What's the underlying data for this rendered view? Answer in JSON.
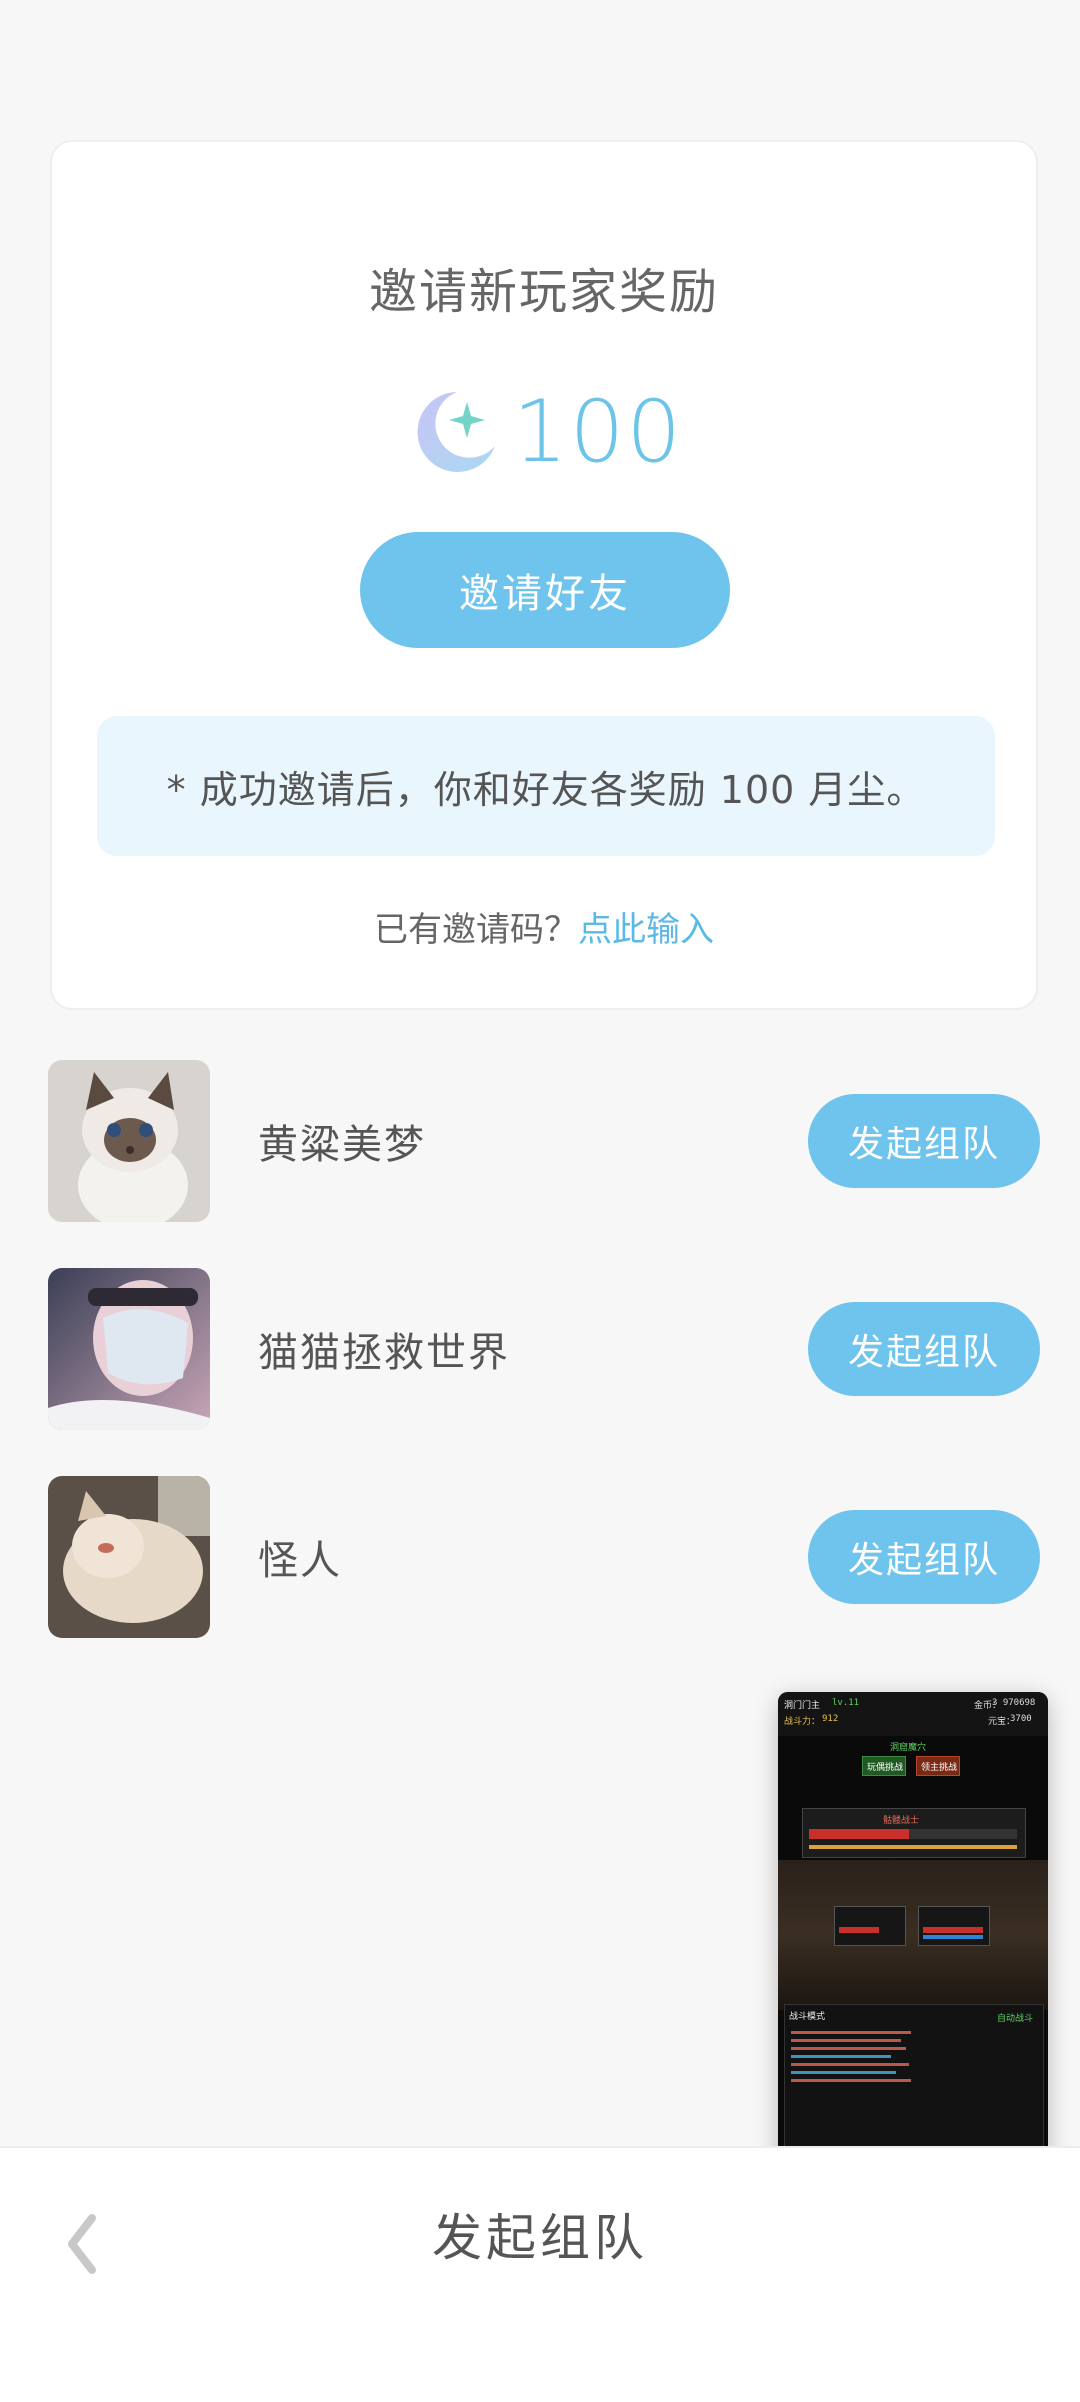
{
  "invite": {
    "title": "邀请新玩家奖励",
    "reward_icon": "moon-star-icon",
    "reward_amount": "100",
    "invite_button": "邀请好友",
    "notice": "* 成功邀请后，你和好友各奖励 100 月尘。",
    "code_prompt": "已有邀请码？",
    "code_link": "点此输入"
  },
  "friends": [
    {
      "name": "黄粱美梦",
      "button": "发起组队"
    },
    {
      "name": "猫猫拯救世界",
      "button": "发起组队"
    },
    {
      "name": "怪人",
      "button": "发起组队"
    }
  ],
  "game_window": {
    "location": "洞门门主",
    "level": "lv.11",
    "power_label": "战斗力：",
    "power": "912",
    "gold_label": "金币：",
    "gold": "3 970698",
    "exp_label": "元宝：",
    "exp": "3700",
    "stage": "洞窟魔穴",
    "btn_left": "玩偶挑战",
    "btn_right": "领主挑战",
    "enemy": "骷髅战士",
    "log_title": "战斗模式",
    "auto_label": "自动战斗"
  },
  "bottom_bar": {
    "back_icon": "chevron-left-icon",
    "title": "发起组队"
  },
  "colors": {
    "accent": "#6ec4ec",
    "notice_bg": "#e9f6fd",
    "link": "#5bb9e6"
  }
}
